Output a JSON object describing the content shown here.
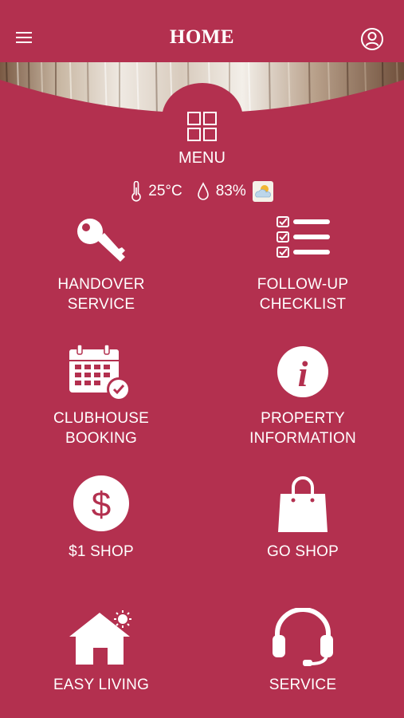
{
  "header": {
    "title": "HOME"
  },
  "menu": {
    "label": "MENU"
  },
  "weather": {
    "temperature": "25°C",
    "humidity": "83%"
  },
  "tiles": [
    {
      "line1": "HANDOVER",
      "line2": "SERVICE"
    },
    {
      "line1": "FOLLOW-UP",
      "line2": "CHECKLIST"
    },
    {
      "line1": "CLUBHOUSE",
      "line2": "BOOKING"
    },
    {
      "line1": "PROPERTY",
      "line2": "INFORMATION"
    },
    {
      "line1": "$1 SHOP"
    },
    {
      "line1": "GO SHOP"
    },
    {
      "line1": "EASY LIVING"
    },
    {
      "line1": "SERVICE"
    }
  ],
  "colors": {
    "background": "#b3304f",
    "foreground": "#ffffff"
  }
}
